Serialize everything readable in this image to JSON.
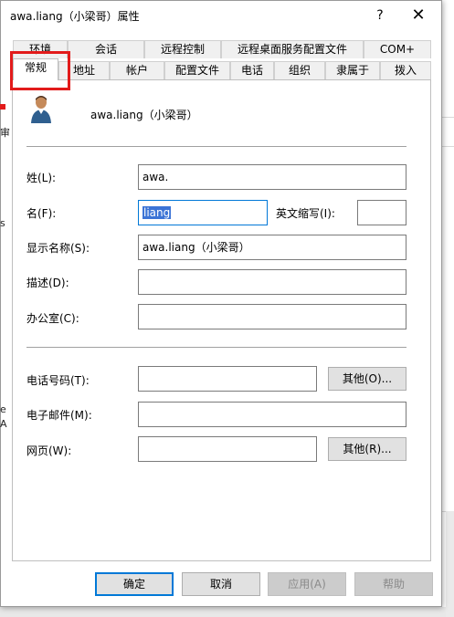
{
  "window": {
    "title": "awa.liang（小梁哥）属性",
    "help_label": "?",
    "close_label": "✕"
  },
  "tabs_back": [
    "环境",
    "会话",
    "远程控制",
    "远程桌面服务配置文件",
    "COM+"
  ],
  "tabs_front": [
    "常规",
    "地址",
    "帐户",
    "配置文件",
    "电话",
    "组织",
    "隶属于",
    "拨入"
  ],
  "general": {
    "display_header": "awa.liang（小梁哥）",
    "last_name_label": "姓(L):",
    "last_name_value": "awa.",
    "first_name_label": "名(F):",
    "first_name_value": "liang",
    "initials_label": "英文缩写(I):",
    "initials_value": "",
    "display_name_label": "显示名称(S):",
    "display_name_value": "awa.liang（小梁哥）",
    "description_label": "描述(D):",
    "description_value": "",
    "office_label": "办公室(C):",
    "office_value": "",
    "phone_label": "电话号码(T):",
    "phone_value": "",
    "phone_other_button": "其他(O)...",
    "email_label": "电子邮件(M):",
    "email_value": "",
    "web_label": "网页(W):",
    "web_value": "",
    "web_other_button": "其他(R)..."
  },
  "footer": {
    "ok": "确定",
    "cancel": "取消",
    "apply": "应用(A)",
    "help": "帮助"
  },
  "background_fragments": [
    "审",
    "s",
    "e",
    "A"
  ]
}
